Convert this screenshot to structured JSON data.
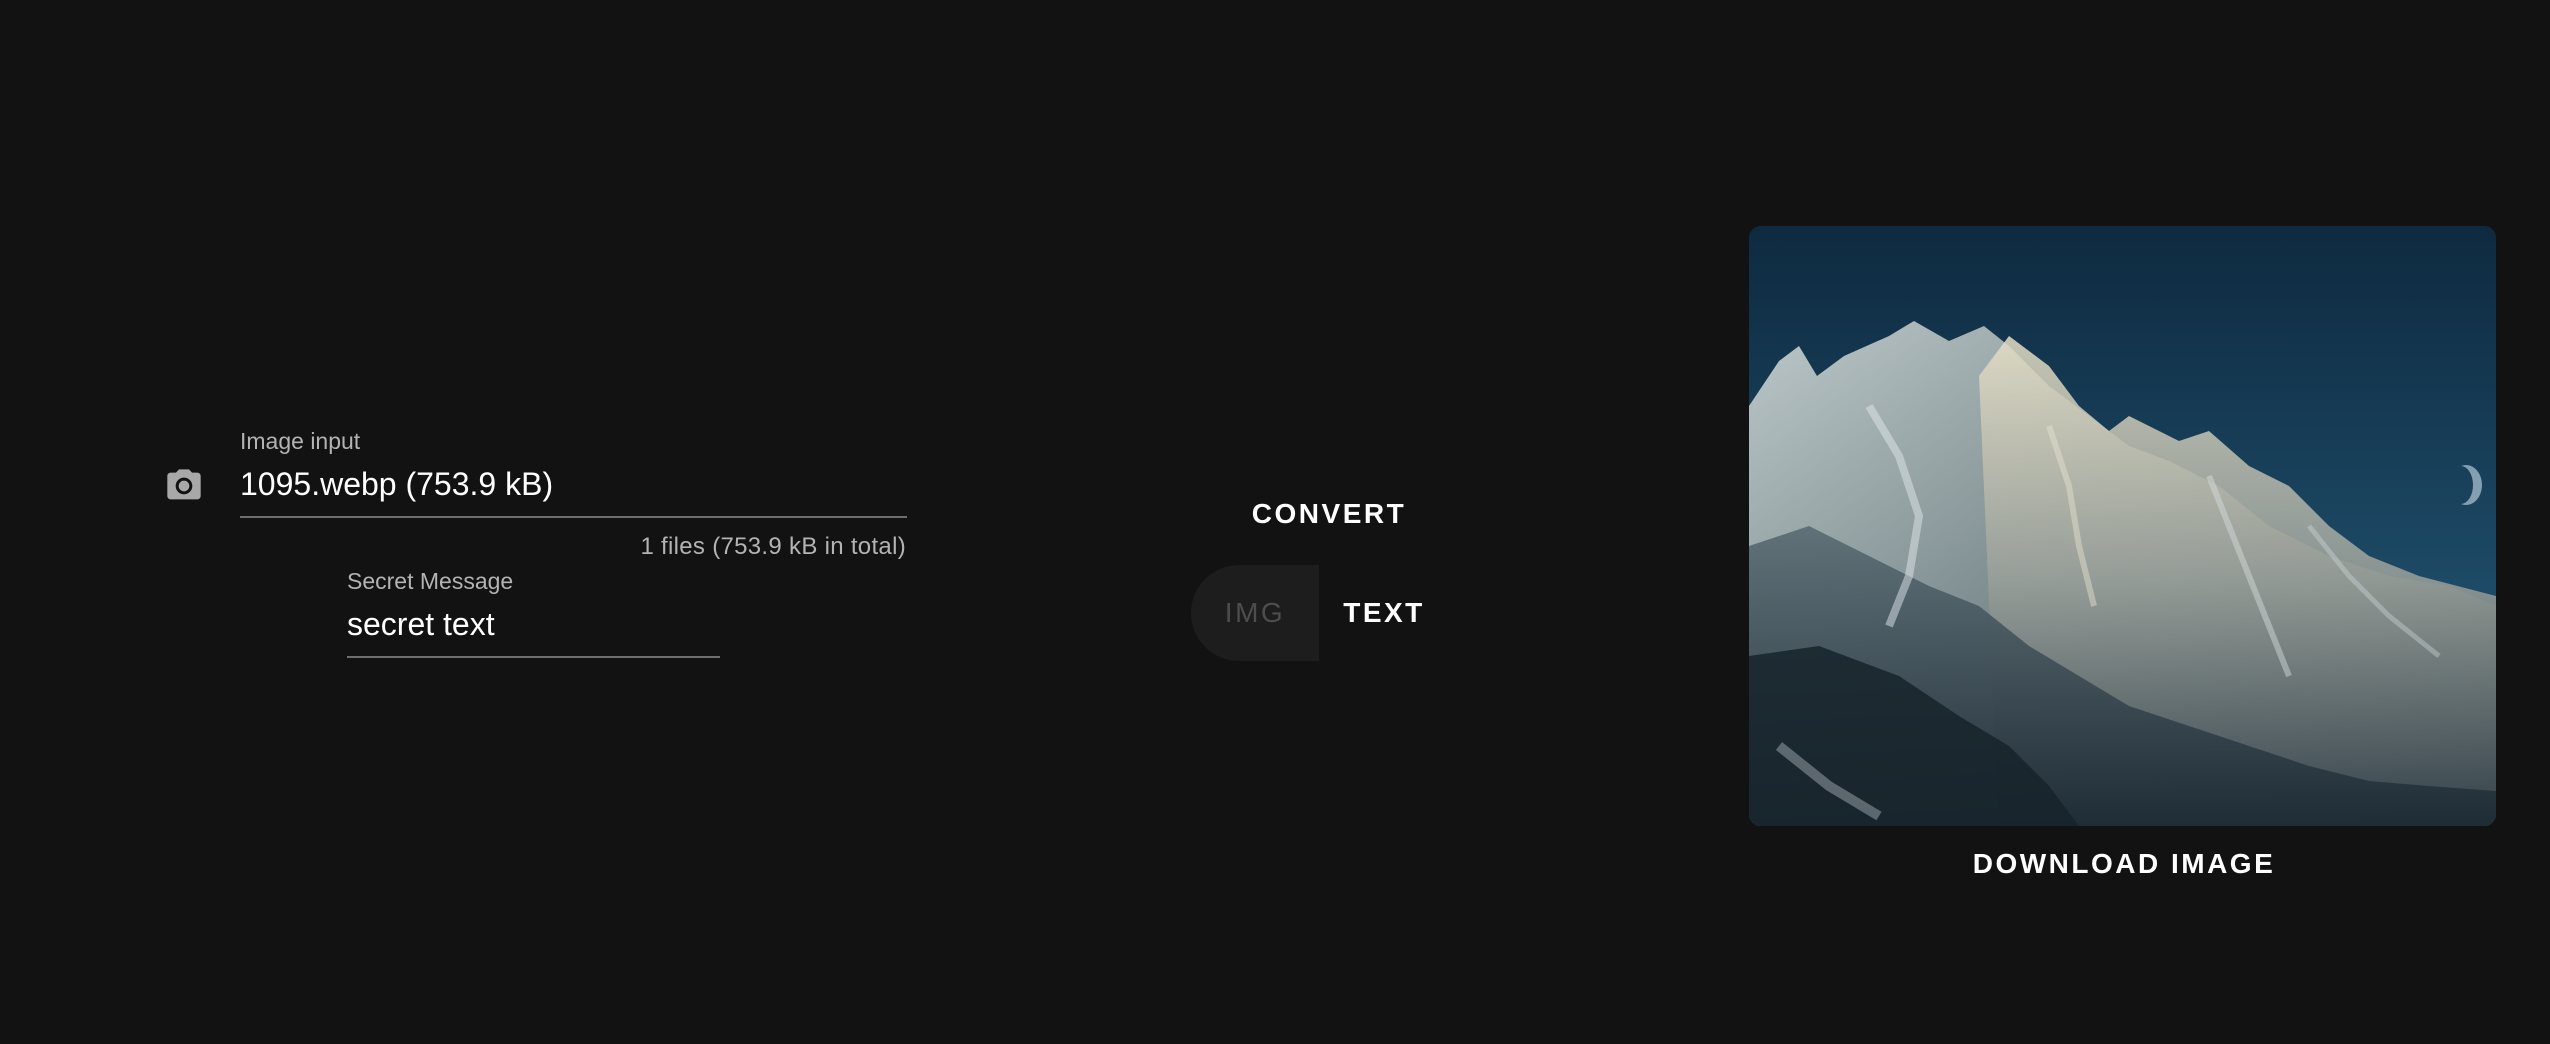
{
  "file_input": {
    "label": "Image input",
    "value": "1095.webp (753.9 kB)",
    "hint": "1 files (753.9 kB in total)",
    "icon": "camera-icon"
  },
  "secret_message": {
    "label": "Secret Message",
    "value": "secret text"
  },
  "actions": {
    "convert_label": "CONVERT",
    "download_label": "DOWNLOAD IMAGE"
  },
  "toggle": {
    "options": [
      "IMG",
      "TEXT"
    ],
    "selected": "TEXT"
  },
  "colors": {
    "background": "#121212",
    "text": "#ffffff",
    "muted": "#b3b3b3",
    "underline": "#6e6e6e",
    "toggle_inactive_bg": "#1d1d1d",
    "toggle_inactive_text": "#4d4d4d"
  }
}
